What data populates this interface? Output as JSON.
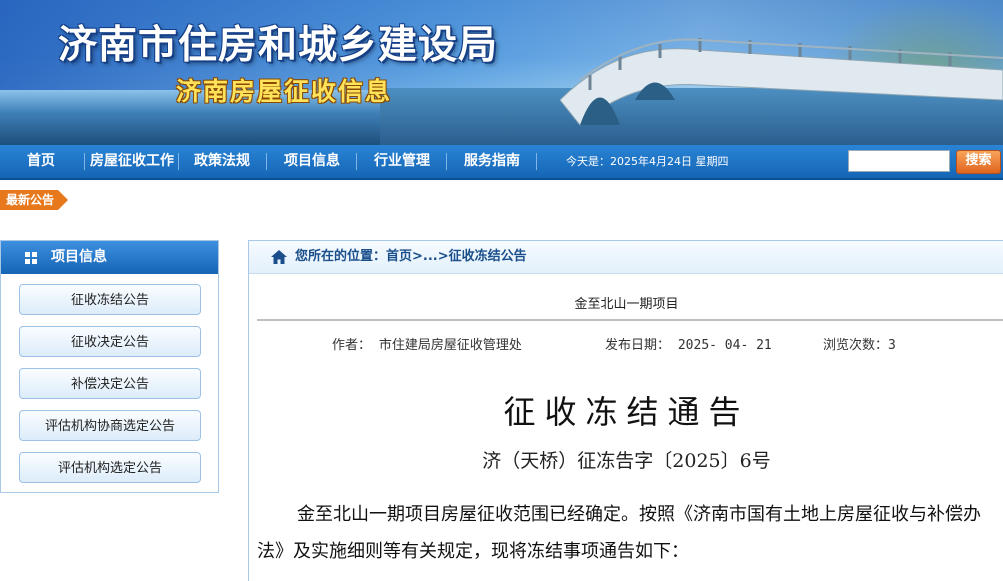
{
  "header": {
    "site_title": "济南市住房和城乡建设局",
    "site_subtitle": "济南房屋征收信息"
  },
  "nav": {
    "items": [
      {
        "label": "首页"
      },
      {
        "label": "房屋征收工作"
      },
      {
        "label": "政策法规"
      },
      {
        "label": "项目信息"
      },
      {
        "label": "行业管理"
      },
      {
        "label": "服务指南"
      }
    ],
    "today": "今天是：2025年4月24日 星期四",
    "search_placeholder": "",
    "search_button": "搜索"
  },
  "news_tag": "最新公告",
  "sidebar": {
    "title": "项目信息",
    "items": [
      {
        "label": "征收冻结公告"
      },
      {
        "label": "征收决定公告"
      },
      {
        "label": "补偿决定公告"
      },
      {
        "label": "评估机构协商选定公告"
      },
      {
        "label": "评估机构选定公告"
      }
    ]
  },
  "main": {
    "breadcrumb": {
      "prefix": "您所在的位置：",
      "home": "首页",
      "sep": ">...>",
      "current": "征收冻结公告"
    },
    "project_title": "金至北山一期项目",
    "meta": {
      "author_label": "作者：",
      "author": "市住建局房屋征收管理处",
      "date_label": "发布日期：",
      "date": "2025- 04- 21",
      "views_label": "浏览次数：",
      "views": "3"
    },
    "notice_title": "征收冻结通告",
    "doc_number": "济（天桥）征冻告字〔2025〕6号",
    "body": "金至北山一期项目房屋征收范围已经确定。按照《济南市国有土地上房屋征收与补偿办法》及实施细则等有关规定，现将冻结事项通告如下："
  },
  "colors": {
    "nav_blue": "#1565b5",
    "accent_orange": "#e8781c",
    "title_yellow": "#fde25a"
  }
}
